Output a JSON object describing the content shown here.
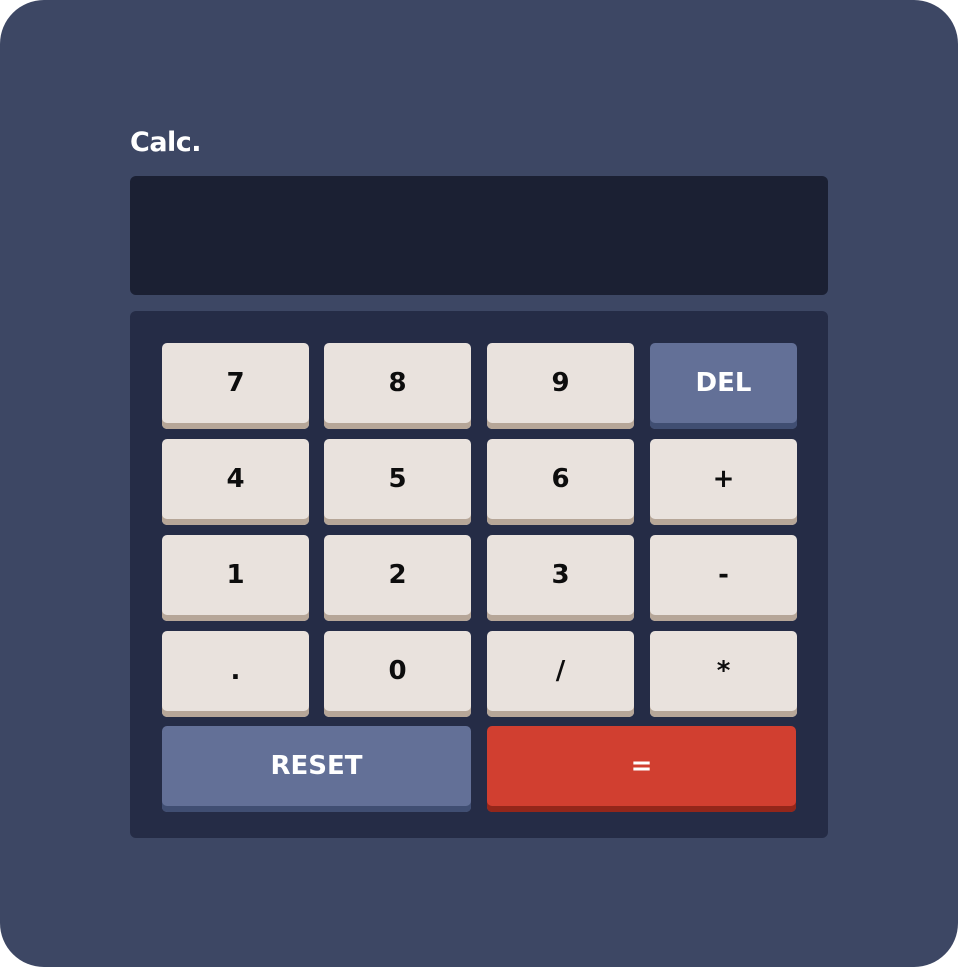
{
  "app": {
    "title": "Calc.",
    "display_value": ""
  },
  "colors": {
    "background": "#3d4764",
    "screen": "#1b2033",
    "keypad": "#252c46",
    "key": "#e9e2dd",
    "key_shadow": "#b6a698",
    "key_blue": "#637097",
    "key_red": "#d13f30"
  },
  "keys": {
    "seven": "7",
    "eight": "8",
    "nine": "9",
    "del": "DEL",
    "four": "4",
    "five": "5",
    "six": "6",
    "plus": "+",
    "one": "1",
    "two": "2",
    "three": "3",
    "minus": "-",
    "dot": ".",
    "zero": "0",
    "divide": "/",
    "multiply": "*",
    "reset": "RESET",
    "equals": "="
  }
}
